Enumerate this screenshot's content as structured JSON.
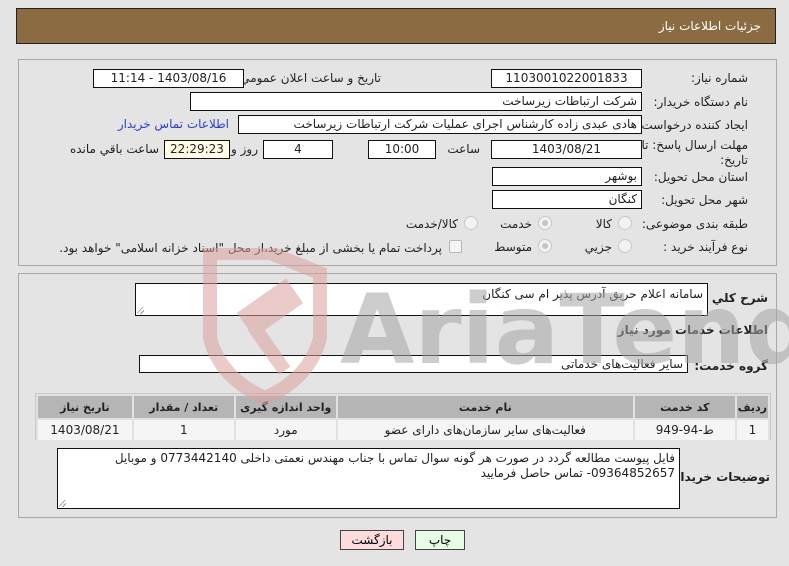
{
  "header": {
    "title": "جزئیات اطلاعات نیاز"
  },
  "form": {
    "need_number_label": "شماره نیاز:",
    "need_number": "1103001022001833",
    "announce_label": "تاریخ و ساعت اعلان عمومي:",
    "announce_value": "1403/08/16 - 11:14",
    "buyer_org_label": "نام دستگاه خریدار:",
    "buyer_org": "شرکت ارتباطات زیرساخت",
    "creator_label": "ایجاد کننده درخواست:",
    "creator": "هادی عبدی زاده کارشناس اجرای عملیات شرکت ارتباطات زیرساخت",
    "buyer_contact_link": "اطلاعات تماس خریدار",
    "deadline_label": "مهلت ارسال پاسخ: تا تاریخ:",
    "deadline_date": "1403/08/21",
    "time_label": "ساعت",
    "deadline_time": "10:00",
    "days_value": "4",
    "days_label": "روز و",
    "remaining_time": "22:29:23",
    "remaining_label": "ساعت باقي مانده",
    "province_label": "استان محل تحویل:",
    "province": "بوشهر",
    "city_label": "شهر محل تحویل:",
    "city": "کنگان",
    "category_label": "طبقه بندی موضوعی:",
    "category_options": [
      {
        "label": "کالا",
        "selected": false
      },
      {
        "label": "خدمت",
        "selected": true
      },
      {
        "label": "کالا/خدمت",
        "selected": false
      }
    ],
    "process_label": "نوع فرآیند خرید :",
    "process_options": [
      {
        "label": "جزیي",
        "selected": false
      },
      {
        "label": "متوسط",
        "selected": true
      }
    ],
    "treasury_checkbox_label": "پرداخت تمام یا بخشی از مبلغ خرید،از محل \"اسناد خزانه اسلامی\" خواهد بود.",
    "treasury_checked": false
  },
  "details": {
    "summary_label": "شرح کلي نیاز:",
    "summary": "سامانه اعلام حریق آدرس پذیر ام سی کنگان",
    "services_heading": "اطلاعات خدمات مورد نیاز",
    "service_group_label": "گروه خدمت:",
    "service_group": "سایر فعالیت‌های خدماتی",
    "table": {
      "columns": [
        "ردیف",
        "کد خدمت",
        "نام خدمت",
        "واحد اندازه گیری",
        "تعداد / مقدار",
        "تاریخ نیاز"
      ],
      "rows": [
        [
          "1",
          "ط-94-949",
          "فعالیت‌های سایر سازمان‌های دارای عضو",
          "مورد",
          "1",
          "1403/08/21"
        ]
      ]
    },
    "buyer_notes_label": "توضیحات خریدار:",
    "buyer_notes": "فایل پیوست مطالعه گردد در صورت هر گونه سوال تماس با جناب مهندس نعمتی داخلی 0773442140 و موبایل 09364852657- تماس حاصل فرمایید"
  },
  "buttons": {
    "print": "چاپ",
    "back": "بازگشت"
  },
  "colors": {
    "header_bg": "#8b6b42",
    "print_bg": "#e6fce6",
    "back_bg": "#fcdcdc",
    "link": "#2d3fbf"
  },
  "watermark": {
    "text": "AriaTender.net"
  }
}
